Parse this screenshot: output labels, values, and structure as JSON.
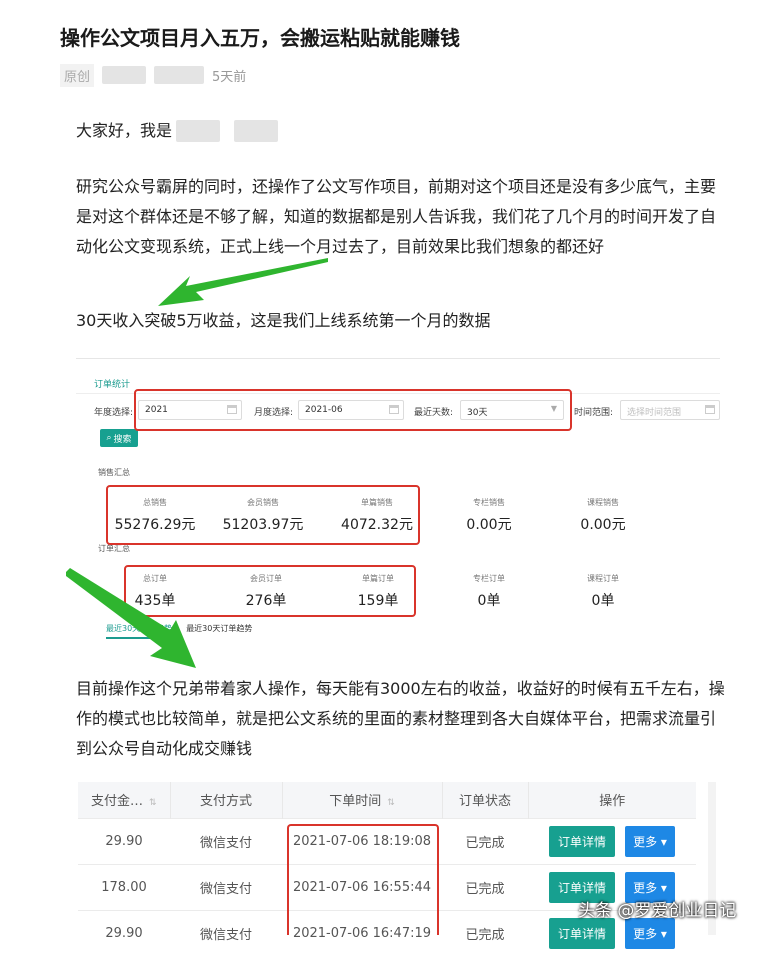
{
  "article": {
    "title": "操作公文项目月入五万，会搬运粘贴就能赚钱",
    "tag": "原创",
    "time_ago": "5天前",
    "greeting": "大家好，我是",
    "paragraph1": "研究公众号霸屏的同时，还操作了公文写作项目，前期对这个项目还是没有多少底气，主要是对这个群体还是不够了解，知道的数据都是别人告诉我，我们花了几个月的时间开发了自动化公文变现系统，正式上线一个月过去了，目前效果比我们想象的都还好",
    "paragraph2": "30天收入突破5万收益，这是我们上线系统第一个月的数据",
    "paragraph3": "目前操作这个兄弟带着家人操作，每天能有3000左右的收益，收益好的时候有五千左右，操作的模式也比较简单，就是把公文系统的里面的素材整理到各大自媒体平台，把需求流量引到公众号自动化成交赚钱"
  },
  "stats_panel": {
    "tab_title": "订单统计",
    "filters": {
      "year_label": "年度选择:",
      "year_value": "2021",
      "month_label": "月度选择:",
      "month_value": "2021-06",
      "days_label": "最近天数:",
      "days_value": "30天",
      "range_label": "时间范围:",
      "range_placeholder": "选择时间范围"
    },
    "search_label": "搜索",
    "sales_section": "销售汇总",
    "sales": [
      {
        "label": "总销售",
        "value": "55276.29元"
      },
      {
        "label": "会员销售",
        "value": "51203.97元"
      },
      {
        "label": "单篇销售",
        "value": "4072.32元"
      },
      {
        "label": "专栏销售",
        "value": "0.00元"
      },
      {
        "label": "课程销售",
        "value": "0.00元"
      }
    ],
    "orders_section": "订单汇总",
    "orders": [
      {
        "label": "总订单",
        "value": "435单"
      },
      {
        "label": "会员订单",
        "value": "276单"
      },
      {
        "label": "单篇订单",
        "value": "159单"
      },
      {
        "label": "专栏订单",
        "value": "0单"
      },
      {
        "label": "课程订单",
        "value": "0单"
      }
    ],
    "trend_tabs": [
      "最近30天销售趋势",
      "最近30天订单趋势"
    ]
  },
  "orders_table": {
    "headers": [
      "支付金…",
      "支付方式",
      "下单时间",
      "订单状态",
      "操作"
    ],
    "rows": [
      {
        "amount": "29.90",
        "method": "微信支付",
        "time": "2021-07-06 18:19:08",
        "status": "已完成"
      },
      {
        "amount": "178.00",
        "method": "微信支付",
        "time": "2021-07-06 16:55:44",
        "status": "已完成"
      },
      {
        "amount": "29.90",
        "method": "微信支付",
        "time": "2021-07-06 16:47:19",
        "status": "已完成"
      }
    ],
    "detail_button": "订单详情",
    "more_button": "更多"
  },
  "watermark": "头条 @罗爱创业日记",
  "colors": {
    "accent_teal": "#17a090",
    "accent_blue": "#1e88e5",
    "highlight_red": "#d9342b",
    "arrow_green": "#2fb52f"
  }
}
